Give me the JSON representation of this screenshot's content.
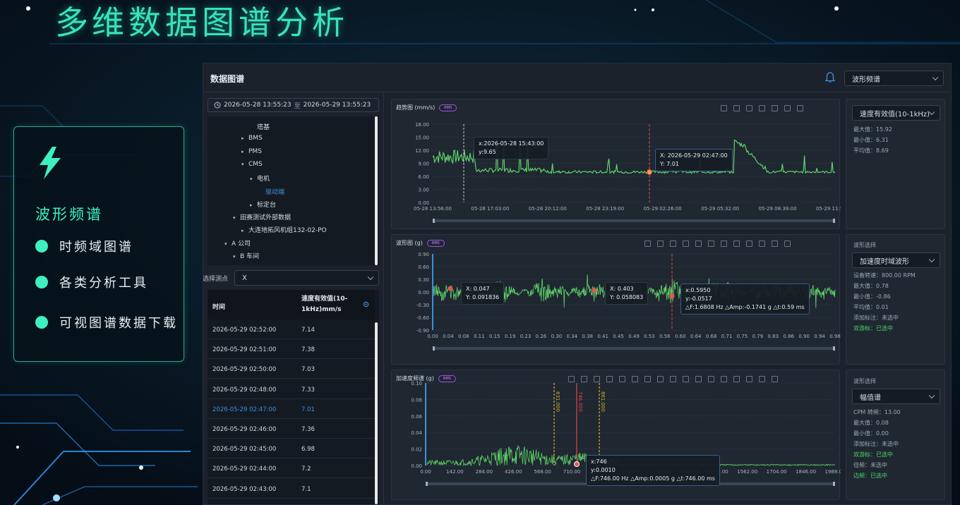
{
  "page_title": "多维数据图谱分析",
  "feature_panel": {
    "heading": "波形频谱",
    "items": [
      {
        "label": "时频域图谱"
      },
      {
        "label": "各类分析工具"
      },
      {
        "label": "可视图谱数据下载"
      }
    ]
  },
  "app": {
    "title": "数据图谱",
    "view_select": "波形频谱",
    "date_start": "2026-05-28 13:55:23",
    "date_sep": "至",
    "date_end": "2026-05-29 13:55:23",
    "tree": [
      {
        "label": "塔基",
        "level": 5,
        "arrow": ""
      },
      {
        "label": "BMS",
        "level": 4,
        "arrow": "▸"
      },
      {
        "label": "PMS",
        "level": 4,
        "arrow": "▸"
      },
      {
        "label": "CMS",
        "level": 4,
        "arrow": "▾"
      },
      {
        "label": "电机",
        "level": 5,
        "arrow": "▾"
      },
      {
        "label": "驱动端",
        "level": 6,
        "arrow": "",
        "active": true
      },
      {
        "label": "标定台",
        "level": 5,
        "arrow": "▸"
      },
      {
        "label": "田赛测试外部数据",
        "level": 3,
        "arrow": "▾"
      },
      {
        "label": "大连地拓风机组132-02-PO",
        "level": 4,
        "arrow": "▸"
      },
      {
        "label": "A 公司",
        "level": 2,
        "arrow": "▾"
      },
      {
        "label": "B 车间",
        "level": 3,
        "arrow": "▾"
      }
    ],
    "point_label": "选择测点",
    "point_value": "X",
    "table": {
      "col_time": "时间",
      "col_value": "速度有效值(10-1kHz)mm/s",
      "rows": [
        {
          "time": "2026-05-29 02:52:00",
          "value": "7.14"
        },
        {
          "time": "2026-05-29 02:51:00",
          "value": "7.38"
        },
        {
          "time": "2026-05-29 02:50:00",
          "value": "7.03"
        },
        {
          "time": "2026-05-29 02:48:00",
          "value": "7.33"
        },
        {
          "time": "2026-05-29 02:47:00",
          "value": "7.01",
          "selected": true
        },
        {
          "time": "2026-05-29 02:46:00",
          "value": "7.36"
        },
        {
          "time": "2026-05-29 02:45:00",
          "value": "6.98"
        },
        {
          "time": "2026-05-29 02:44:00",
          "value": "7.2"
        },
        {
          "time": "2026-05-29 02:43:00",
          "value": "7.1"
        }
      ]
    }
  },
  "trend": {
    "title": "趋势图 (mm/s)",
    "badge": "RMS",
    "tip1": [
      "x:2026-05-28 15:43:00",
      "y:9.65"
    ],
    "tip2": [
      "X:  2026-05-29 02:47:00",
      "Y:  7.01"
    ],
    "side": {
      "select": "速度有效值(10-1kHz)",
      "max": "最大值：15.92",
      "min": "最小值：6.31",
      "avg": "平均值：8.69"
    }
  },
  "wave": {
    "title": "波形图 (g)",
    "badge": "RMS",
    "tip1": [
      "X: 0.047",
      "Y: 0.091836"
    ],
    "tip2": [
      "X: 0.403",
      "Y: 0.058083"
    ],
    "tip3": [
      "x:0.5950",
      "y:-0.0517",
      "△F:1.6808 Hz △Amp:-0.1741 g △t:0.59 ms"
    ],
    "side": {
      "label": "波形选择",
      "select": "加速度时域波形",
      "lines": [
        {
          "text": "设备转速：800.00 RPM"
        },
        {
          "text": "最大值：0.78"
        },
        {
          "text": "最小值：-0.86"
        },
        {
          "text": "平均值：0.01"
        },
        {
          "text": "添加标注：未选中"
        },
        {
          "text": "双游标：已选中",
          "green": true
        }
      ]
    }
  },
  "spectrum": {
    "title": "加速度频谱 (g)",
    "badge": "RMS",
    "tip": [
      "x:746",
      "y:0.0010",
      "△F:746.00 Hz △Amp:0.0005 g △t:746.00 ms"
    ],
    "markers": [
      "631.000",
      "746.000",
      "861.000"
    ],
    "side": {
      "label": "波形选择",
      "select": "幅值谱",
      "lines": [
        {
          "text": "CPM 转频：13.00"
        },
        {
          "text": "最大值：0.08"
        },
        {
          "text": "最小值：0.00"
        },
        {
          "text": "添加标注：未选中"
        },
        {
          "text": "双游标：已选中",
          "green": true
        },
        {
          "text": "倍频：未选中"
        },
        {
          "text": "边频：已选中",
          "green": true
        }
      ]
    }
  },
  "chart_data": [
    {
      "type": "line",
      "title": "趋势图 (mm/s)",
      "x_ticks": [
        "05-28 13:56:00",
        "05-28 17:03:00",
        "05-28 20:12:00",
        "05-28 23:19:00",
        "05-29 02:26:00",
        "05-29 05:32:00",
        "05-29 08:39:00",
        "05-29 11:51:00"
      ],
      "y_ticks": [
        "18.00",
        "15.00",
        "12.00",
        "9.00",
        "6.00",
        "3.00",
        "0.00"
      ],
      "ylim": [
        0,
        18
      ],
      "series": [
        {
          "color": "#5fd36a"
        }
      ]
    },
    {
      "type": "line",
      "title": "波形图 (g)",
      "x_ticks": [
        "0.00",
        "0.04",
        "0.08",
        "0.11",
        "0.15",
        "0.19",
        "0.23",
        "0.26",
        "0.30",
        "0.34",
        "0.38",
        "0.41",
        "0.45",
        "0.49",
        "0.53",
        "0.56",
        "0.60",
        "0.64",
        "0.68",
        "0.71",
        "0.75",
        "0.79",
        "0.83",
        "0.86",
        "0.90",
        "0.94",
        "0.98"
      ],
      "y_ticks": [
        "0.90",
        "0.60",
        "0.30",
        "0.00",
        "-0.30",
        "-0.60",
        "-0.90"
      ],
      "ylim": [
        -0.9,
        0.9
      ],
      "series": [
        {
          "color": "#5fd36a"
        }
      ]
    },
    {
      "type": "line",
      "title": "加速度频谱 (g)",
      "x_ticks": [
        "0.00",
        "142.00",
        "284.00",
        "426.00",
        "568.00",
        "710.00",
        "852.00",
        "994.00",
        "1136.00",
        "1278.00",
        "1420.00",
        "1562.00",
        "1704.00",
        "1846.00",
        "1988.00"
      ],
      "y_ticks": [
        "0.10",
        "0.08",
        "0.06",
        "0.04",
        "0.02",
        "0.00"
      ],
      "ylim": [
        0,
        0.1
      ],
      "series": [
        {
          "color": "#5fd36a"
        }
      ]
    }
  ]
}
